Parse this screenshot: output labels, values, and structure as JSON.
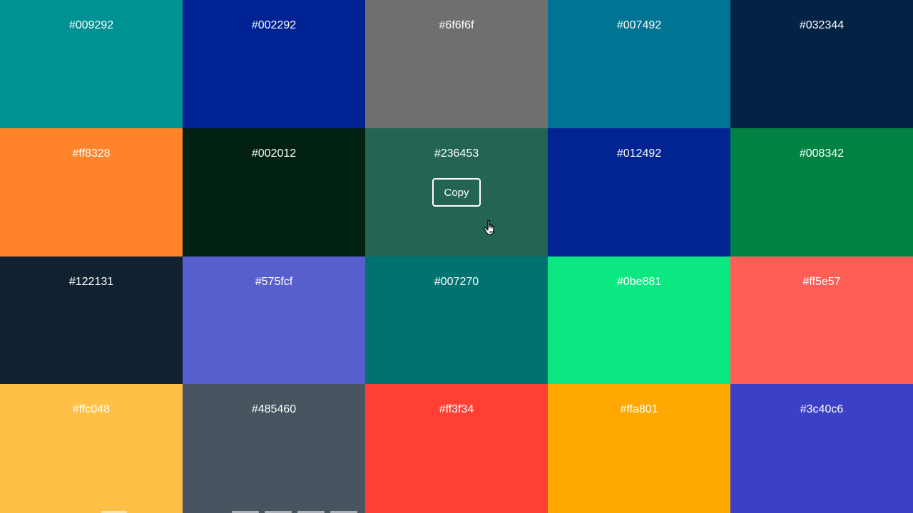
{
  "palette": [
    {
      "hex": "#009292",
      "color": "#009292"
    },
    {
      "hex": "#002292",
      "color": "#002292"
    },
    {
      "hex": "#6f6f6f",
      "color": "#6f6f6f"
    },
    {
      "hex": "#007492",
      "color": "#007492"
    },
    {
      "hex": "#032344",
      "color": "#032344"
    },
    {
      "hex": "#ff8328",
      "color": "#ff8328"
    },
    {
      "hex": "#002012",
      "color": "#002012"
    },
    {
      "hex": "#236453",
      "color": "#236453"
    },
    {
      "hex": "#012492",
      "color": "#012492"
    },
    {
      "hex": "#008342",
      "color": "#008342"
    },
    {
      "hex": "#122131",
      "color": "#122131"
    },
    {
      "hex": "#575fcf",
      "color": "#575fcf"
    },
    {
      "hex": "#007270",
      "color": "#007270"
    },
    {
      "hex": "#0be881",
      "color": "#0be881"
    },
    {
      "hex": "#ff5e57",
      "color": "#ff5e57"
    },
    {
      "hex": "#ffc048",
      "color": "#ffc048"
    },
    {
      "hex": "#485460",
      "color": "#485460"
    },
    {
      "hex": "#ff3f34",
      "color": "#ff3f34"
    },
    {
      "hex": "#ffa801",
      "color": "#ffa801"
    },
    {
      "hex": "#3c40c6",
      "color": "#3c40c6"
    }
  ],
  "copy_button": {
    "label": "Copy",
    "swatch_index": 7
  },
  "cursor": {
    "icon": "hand-pointer-icon"
  }
}
